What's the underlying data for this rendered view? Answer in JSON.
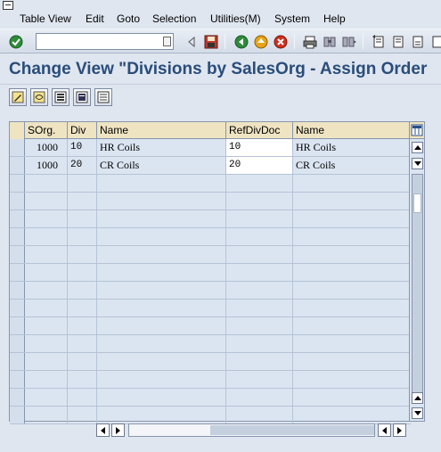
{
  "menu": {
    "items": [
      {
        "label": "Table View"
      },
      {
        "label": "Edit"
      },
      {
        "label": "Goto"
      },
      {
        "label": "Selection"
      },
      {
        "label": "Utilities(M)"
      },
      {
        "label": "System"
      },
      {
        "label": "Help"
      }
    ]
  },
  "toolbar": {
    "command_value": ""
  },
  "page": {
    "title": "Change View \"Divisions by SalesOrg - Assign Order"
  },
  "table": {
    "columns": [
      "SOrg.",
      "Div",
      "Name",
      "RefDivDoc",
      "Name"
    ],
    "rows": [
      {
        "sorg": "1000",
        "div": "10",
        "name": "HR Coils",
        "refdiv": "10",
        "refname": "HR Coils"
      },
      {
        "sorg": "1000",
        "div": "20",
        "name": "CR Coils",
        "refdiv": "20",
        "refname": "CR Coils"
      }
    ]
  },
  "colors": {
    "title": "#2a4d7a",
    "header_bg": "#efe4c2",
    "table_bg": "#dbe5f1"
  },
  "icons": {
    "toolbar": [
      "check-icon",
      "back-arrow-icon",
      "save-icon",
      "back-icon",
      "exit-icon",
      "cancel-icon",
      "print-icon",
      "find-icon",
      "find-next-icon",
      "first-page-icon",
      "prev-page-icon",
      "next-page-icon"
    ],
    "app": [
      "edit-pencil-icon",
      "other-view-icon",
      "select-all-icon",
      "select-block-icon",
      "deselect-all-icon"
    ]
  }
}
